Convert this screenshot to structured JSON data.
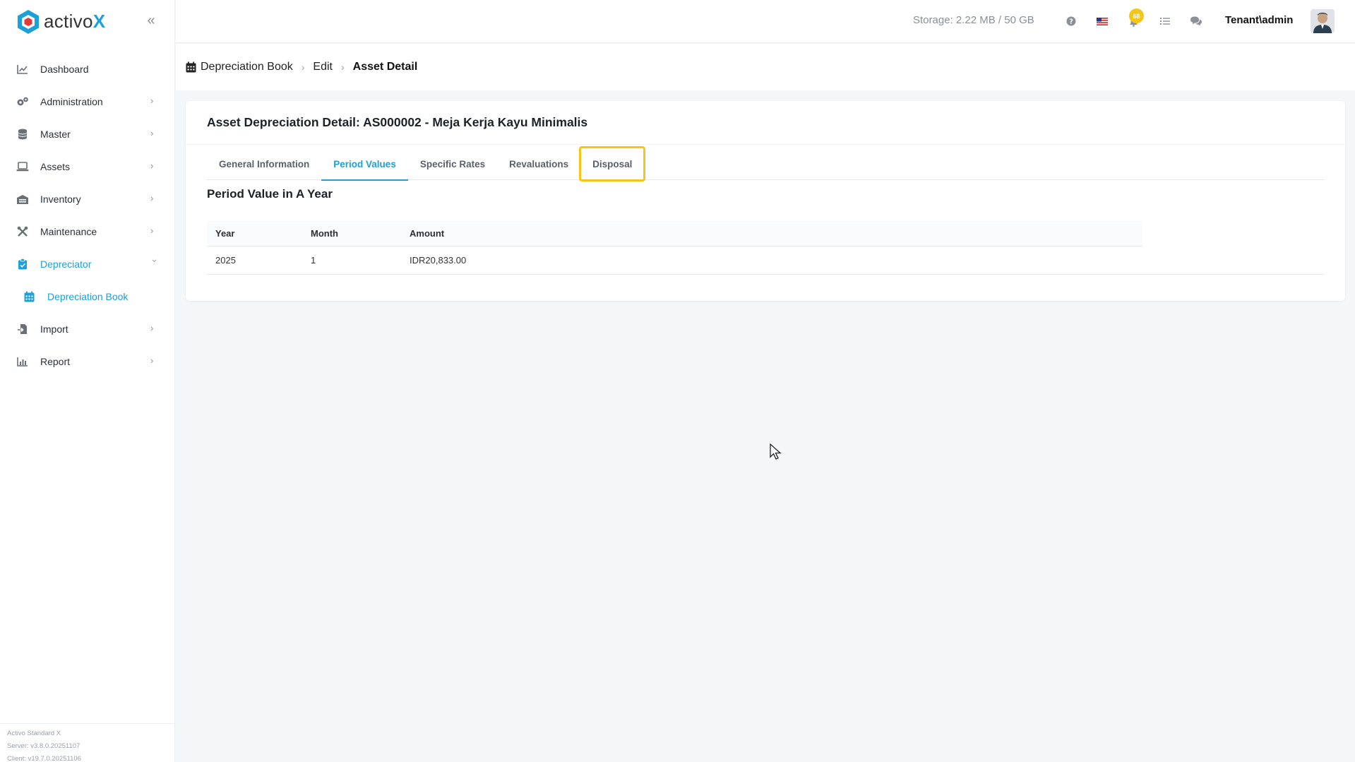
{
  "app": {
    "logo_text": "activo",
    "logo_x": "X",
    "brand_color": "#1ba0d8"
  },
  "sidebar": {
    "items": [
      {
        "label": "Dashboard",
        "icon": "chart-line-icon"
      },
      {
        "label": "Administration",
        "icon": "gears-icon"
      },
      {
        "label": "Master",
        "icon": "database-icon"
      },
      {
        "label": "Assets",
        "icon": "laptop-icon"
      },
      {
        "label": "Inventory",
        "icon": "warehouse-icon"
      },
      {
        "label": "Maintenance",
        "icon": "tools-icon"
      },
      {
        "label": "Depreciator",
        "icon": "clipboard-icon"
      },
      {
        "label": "Depreciation Book",
        "icon": "calendar-icon"
      },
      {
        "label": "Import",
        "icon": "file-import-icon"
      },
      {
        "label": "Report",
        "icon": "chart-bar-icon"
      }
    ],
    "footer": {
      "product": "Activo Standard X",
      "server": "Server: v3.8.0.20251107",
      "client": "Client: v19.7.0.20251106"
    }
  },
  "topbar": {
    "storage": "Storage: 2.22 MB / 50 GB",
    "notification_count": "68",
    "user": "Tenant\\admin"
  },
  "breadcrumb": {
    "root": "Depreciation Book",
    "edit": "Edit",
    "current": "Asset Detail"
  },
  "card": {
    "title": "Asset Depreciation Detail: AS000002 - Meja Kerja Kayu Minimalis",
    "tabs": [
      "General Information",
      "Period Values",
      "Specific Rates",
      "Revaluations",
      "Disposal"
    ],
    "active_tab": "Period Values",
    "section_title": "Period Value in A Year",
    "table": {
      "headers": [
        "Year",
        "Month",
        "Amount"
      ],
      "rows": [
        [
          "2025",
          "1",
          "IDR20,833.00"
        ]
      ]
    }
  }
}
